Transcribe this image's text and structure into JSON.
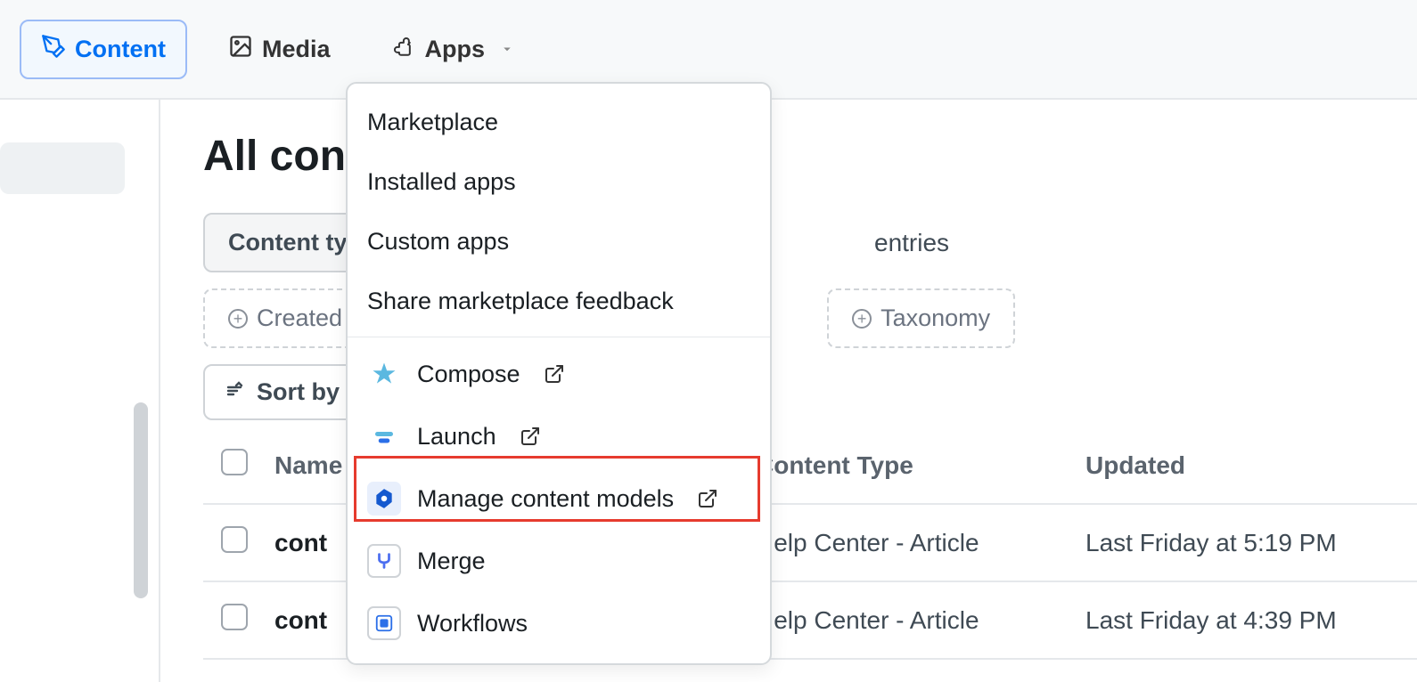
{
  "nav": {
    "content": "Content",
    "media": "Media",
    "apps": "Apps"
  },
  "page": {
    "title": "All content"
  },
  "filters": {
    "content_type": "Content type",
    "entries": "entries",
    "created_by": "Created by",
    "taxonomy": "Taxonomy"
  },
  "sort": {
    "label": "Sort by"
  },
  "table": {
    "headers": {
      "name": "Name",
      "content_type": "Content Type",
      "updated": "Updated"
    },
    "rows": [
      {
        "name": "cont",
        "content_type": "Help Center - Article",
        "updated": "Last Friday at 5:19 PM"
      },
      {
        "name": "cont",
        "content_type": "Help Center - Article",
        "updated": "Last Friday at 4:39 PM"
      }
    ]
  },
  "dropdown": {
    "section1": [
      "Marketplace",
      "Installed apps",
      "Custom apps",
      "Share marketplace feedback"
    ],
    "section2": [
      {
        "label": "Compose",
        "icon": "compose",
        "icon_color": "#5bb8e0",
        "box_bg": "transparent",
        "external": true
      },
      {
        "label": "Launch",
        "icon": "launch",
        "icon_color": "#5bb8e0",
        "box_bg": "transparent",
        "external": true
      },
      {
        "label": "Manage content models",
        "icon": "hexagon",
        "icon_color": "#1559cf",
        "box_bg": "#e8effc",
        "external": true
      },
      {
        "label": "Merge",
        "icon": "merge",
        "icon_color": "#4c6ff0",
        "box_bg": "#fff",
        "box_border": "#cfd3d7",
        "external": false
      },
      {
        "label": "Workflows",
        "icon": "workflows",
        "icon_color": "#2b6fe8",
        "box_bg": "#fff",
        "box_border": "#cfd3d7",
        "external": false
      }
    ]
  }
}
